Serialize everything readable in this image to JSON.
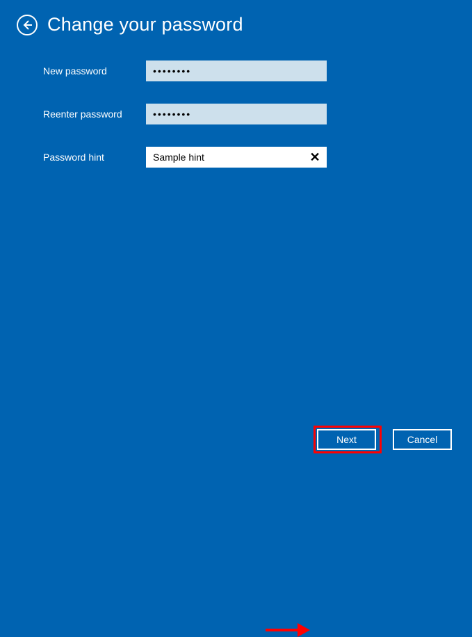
{
  "header": {
    "title": "Change your password"
  },
  "form": {
    "new_password": {
      "label": "New password",
      "value": "••••••••"
    },
    "reenter_password": {
      "label": "Reenter password",
      "value": "••••••••"
    },
    "hint": {
      "label": "Password hint",
      "value": "Sample hint"
    }
  },
  "footer": {
    "next": "Next",
    "cancel": "Cancel"
  }
}
